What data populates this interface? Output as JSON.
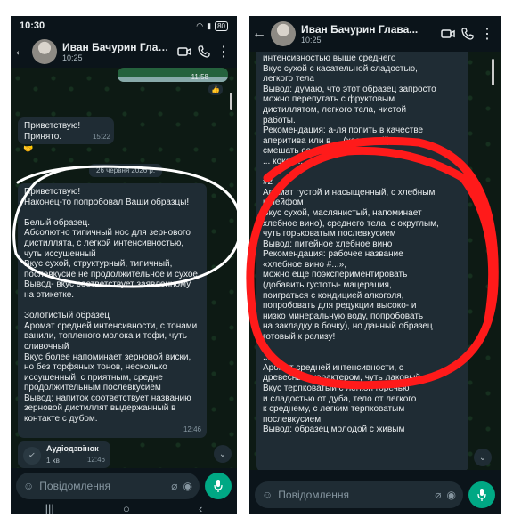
{
  "left": {
    "status": {
      "time": "10:30",
      "battery": "80"
    },
    "header": {
      "name": "Иван Бачурин Глава...",
      "time": "10:25"
    },
    "prev_time": "11:58",
    "greeting": {
      "lines": [
        "Приветствую!",
        "Принято."
      ],
      "time": "15:22"
    },
    "date_chip": "26 червня 2026 р.",
    "message": {
      "lines": [
        "Приветствую!",
        "Наконец-то попробовал Ваши образцы!",
        "",
        "Белый образец.",
        "Абсолютно типичный нос для зернового",
        "дистиллята, с легкой интенсивностью,",
        "чуть иссушенный",
        "Вкус сухой, структурный, типичный,",
        "послевкусие не продолжительное и сухое",
        "Вывод- вкус соответствует заявленному",
        "на этикетке.",
        "",
        "Золотистый образец",
        "Аромат средней интенсивности, с тонами",
        "ванили, топленого молока и тофи, чуть",
        "сливочный",
        "Вкус более напоминает зерновой виски,",
        "но без торфяных тонов, несколько",
        "иссушенный, с приятным, средне",
        "продолжительным послевкусием",
        "Вывод: напиток соответствует названию",
        "зерновой дистиллят выдержанный в",
        "контакте с дубом."
      ],
      "time": "12:46"
    },
    "call": {
      "title": "Аудіодзвінок",
      "duration": "1 хв",
      "time": "12:46"
    },
    "input_placeholder": "Повідомлення"
  },
  "right": {
    "header": {
      "name": "Иван Бачурин Глава...",
      "time": "10:25"
    },
    "message_top": [
      "интенсивностью выше среднего",
      "Вкус сухой с касательной сладостью,",
      "легкого тела",
      "Вывод: думаю, что этот образец запросто",
      "можно перепутать с фруктовым",
      "дистиллятом, легкого тела, чистой",
      "работы.",
      "Рекомендация: а-ля попить в качестве",
      "аперитива или в ... (холодный) или",
      "смешать со ..., тоником и т.д.",
      "... кокой ...",
      "",
      "#2",
      "Аромат густой и насыщенный, с хлебным",
      "шлейфом",
      "Вкус сухой, маслянистый, напоминает",
      "хлебное вино), среднего тела, с округлым,",
      "чуть горьковатым послевкусием",
      "Вывод: питейное хлебное вино",
      "Рекомендация: рабочее название",
      "«хлебное вино #...»,",
      "можно ещё поэкспериментировать",
      "(добавить густоты- мацерация,",
      "поиграться с кондицией алкоголя,",
      "попробовать для редукции высоко- и",
      "низко минеральную воду, попробовать",
      "на закладку в бочку), но данный образец",
      "готовый к релизу!",
      "",
      "...",
      "Аромат средней интенсивности, с",
      "древесным характером, чуть лаковый",
      "Вкус терпковатый с легкой горечью",
      "и сладостью от дуба, тело от легкого",
      "к среднему, с легким терпковатым",
      "послевкусием",
      "Вывод: образец молодой с живым"
    ],
    "input_placeholder": "Повідомлення"
  }
}
